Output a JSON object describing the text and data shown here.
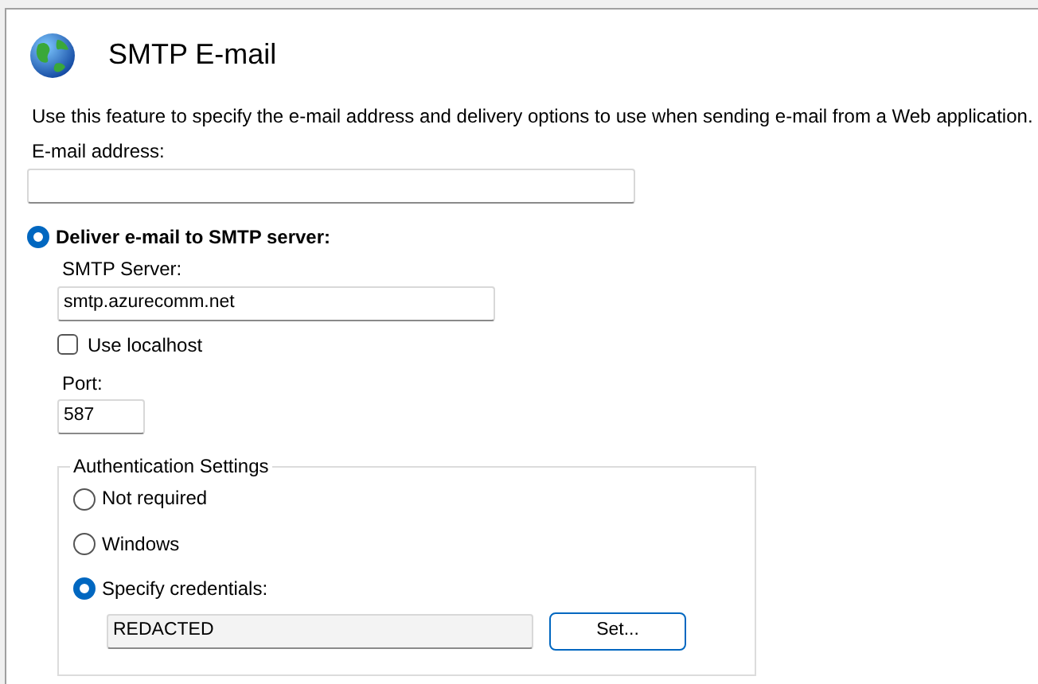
{
  "header": {
    "title": "SMTP E-mail"
  },
  "description": "Use this feature to specify the e-mail address and delivery options to use when sending e-mail from a Web application.",
  "email_address": {
    "label": "E-mail address:"
  },
  "deliver_option": {
    "label": "Deliver e-mail to SMTP server:",
    "selected": true
  },
  "smtp_server": {
    "label": "SMTP Server:",
    "value": "smtp.azurecomm.net"
  },
  "use_localhost": {
    "label": "Use localhost",
    "checked": false
  },
  "port": {
    "label": "Port:",
    "value": "587"
  },
  "authentication": {
    "legend": "Authentication Settings",
    "options": [
      {
        "label": "Not required",
        "selected": false
      },
      {
        "label": "Windows",
        "selected": false
      },
      {
        "label": "Specify credentials:",
        "selected": true
      }
    ],
    "credentials": {
      "value": "REDACTED"
    },
    "set_button": "Set..."
  }
}
